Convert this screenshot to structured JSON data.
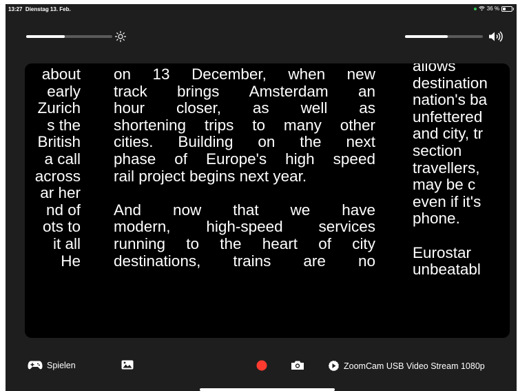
{
  "status_bar": {
    "time": "13:27",
    "date": "Dienstag 13. Feb.",
    "battery": "36 %",
    "battery_level": 0.36
  },
  "controls": {
    "brightness_level": 0.45,
    "volume_level": 0.55
  },
  "viewer": {
    "left_column": [
      "about",
      "early",
      "Zurich",
      "s the",
      "British",
      "a call",
      "across",
      "ar her",
      "nd of",
      "ots to",
      "it all",
      "He"
    ],
    "middle_column": [
      [
        "on",
        "13",
        "December,",
        "when",
        "new"
      ],
      [
        "track",
        "brings",
        "Amsterdam",
        "an"
      ],
      [
        "hour",
        "closer,",
        "as",
        "well",
        "as"
      ],
      [
        "shortening",
        "trips",
        "to",
        "many",
        "other"
      ],
      [
        "cities.",
        "Building",
        "on",
        "the",
        "next"
      ],
      [
        "phase",
        "of",
        "Europe's",
        "high",
        "speed"
      ],
      [
        "rail project begins next year."
      ],
      [],
      [
        "And",
        "now",
        "that",
        "we",
        "have"
      ],
      [
        "modern,",
        "high-speed",
        "services"
      ],
      [
        "running",
        "to",
        "the",
        "heart",
        "of",
        "city"
      ],
      [
        "destinations,",
        "trains",
        "are",
        "no"
      ]
    ],
    "right_column": [
      "allows",
      "destination",
      "nation's ba",
      "unfettered",
      "and city, tr",
      "section",
      "travellers,",
      "may be c",
      "even if it's",
      "phone.",
      "",
      "Eurostar",
      "unbeatabl"
    ]
  },
  "toolbar": {
    "games_label": "Spielen",
    "camera_source": "ZoomCam USB Video Stream 1080p",
    "record_color": "#ff3b30"
  },
  "icons": {
    "games": "gamecontroller-icon",
    "photos": "photo-icon",
    "record": "record-icon",
    "camera": "camera-icon",
    "source": "camera-switch-icon",
    "brightness": "sun-icon",
    "volume": "speaker-icon"
  }
}
